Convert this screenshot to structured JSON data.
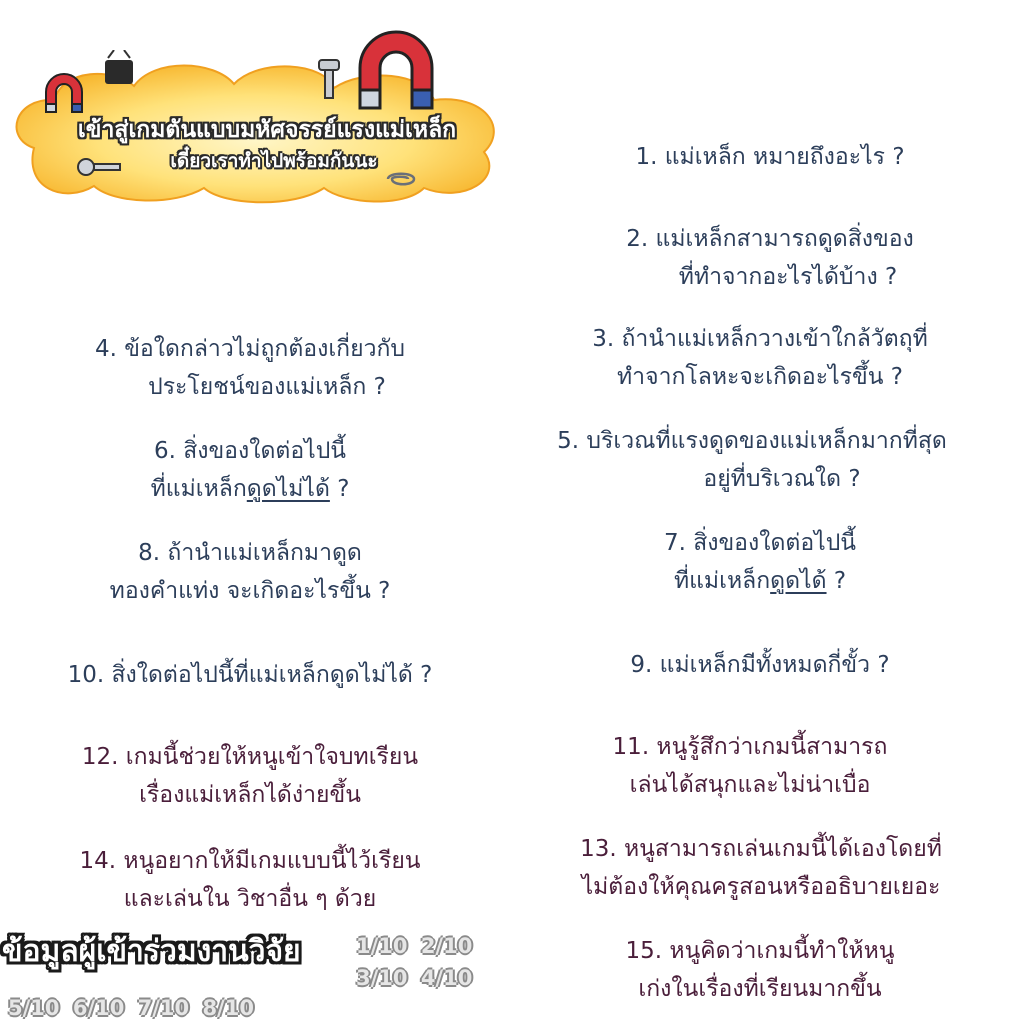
{
  "banner": {
    "title": "เข้าสู่เกมตันแบบมหัศจรรย์แรงแม่เหล็ก",
    "subtitle": "เดี๋ยวเราทำไปพร้อมกันนะ"
  },
  "questions": {
    "q1": "1. แม่เหล็ก หมายถึงอะไร ?",
    "q2_line1": "2. แม่เหล็กสามารถดูดสิ่งของ",
    "q2_line2": "ที่ทำจากอะไรได้บ้าง ?",
    "q3_line1": "3. ถ้านำแม่เหล็กวางเข้าใกล้วัตถุที่",
    "q3_line2": "ทำจากโลหะจะเกิดอะไรขึ้น ?",
    "q4_line1": "4. ข้อใดกล่าวไม่ถูกต้องเกี่ยวกับ",
    "q4_line2": "ประโยชน์ของแม่เหล็ก ?",
    "q5_line1": "5. บริเวณที่แรงดูดของแม่เหล็กมากที่สุด",
    "q5_line2": "อยู่ที่บริเวณใด ?",
    "q6_line1": "6. สิ่งของใดต่อไปนี้",
    "q6_line2_pre": "ที่แม่เหล็ก",
    "q6_line2_u": "ดูดไม่ได้",
    "q6_line2_post": " ?",
    "q7_line1": "7. สิ่งของใดต่อไปนี้",
    "q7_line2_pre": "ที่แม่เหล็ก",
    "q7_line2_u": "ดูดได้",
    "q7_line2_post": " ?",
    "q8_line1": "8. ถ้านำแม่เหล็กมาดูด",
    "q8_line2": "ทองคำแท่ง จะเกิดอะไรขึ้น ?",
    "q9": "9. แม่เหล็กมีทั้งหมดกี่ขั้ว ?",
    "q10": "10. สิ่งใดต่อไปนี้ที่แม่เหล็กดูดไม่ได้ ?",
    "q11_line1": "11. หนูรู้สึกว่าเกมนี้สามารถ",
    "q11_line2": "เล่นได้สนุกและไม่น่าเบื่อ",
    "q12_line1": "12. เกมนี้ช่วยให้หนูเข้าใจบทเรียน",
    "q12_line2": "เรื่องแม่เหล็กได้ง่ายขึ้น",
    "q13_line1": "13. หนูสามารถเล่นเกมนี้ได้เองโดยที่",
    "q13_line2": "ไม่ต้องให้คุณครูสอนหรืออธิบายเยอะ",
    "q14_line1": "14. หนูอยากให้มีเกมแบบนี้ไว้เรียน",
    "q14_line2": "และเล่นใน วิชาอื่น ๆ ด้วย",
    "q15_line1": "15. หนูคิดว่าเกมนี้ทำให้หนู",
    "q15_line2": "เก่งในเรื่องที่เรียนมากขึ้น"
  },
  "research": {
    "title": "ข้อมูลผู้เข้าร่วมงานวิจัย",
    "pages_row1": "1/10 2/10",
    "pages_row2": "3/10 4/10",
    "pages_row3": "5/10 6/10 7/10 8/10"
  },
  "colors": {
    "question_navy": "#2c3e5a",
    "question_maroon": "#4a1e3a",
    "banner_glow": "#ffd84a",
    "magnet_red": "#d8323a",
    "magnet_blue": "#3a5fb0"
  },
  "icons": [
    "magnet-icon",
    "binder-clip-icon",
    "screw-icon",
    "key-icon",
    "paperclip-icon"
  ]
}
